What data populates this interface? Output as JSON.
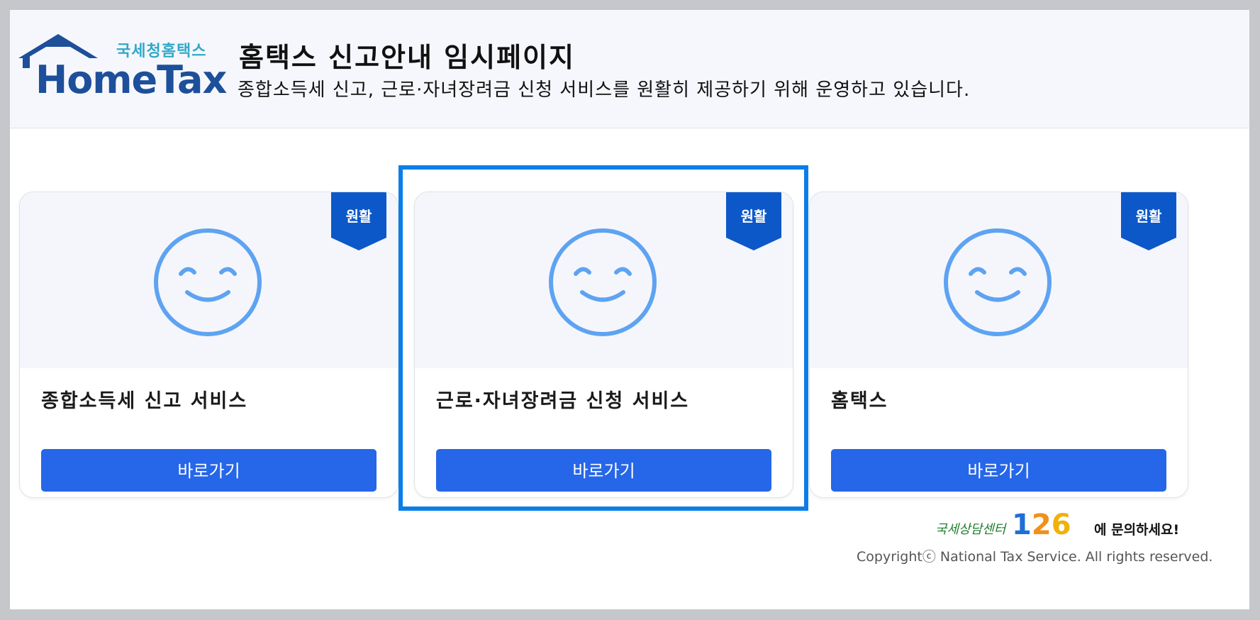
{
  "logo": {
    "subtitle": "국세청홈택스",
    "wordmark": "HomeTax"
  },
  "header": {
    "title": "홈택스 신고안내 임시페이지",
    "description": "종합소득세 신고, 근로·자녀장려금 신청 서비스를 원활히 제공하기 위해 운영하고 있습니다."
  },
  "cards": [
    {
      "status": "원활",
      "title": "종합소득세 신고 서비스",
      "button": "바로가기",
      "icon": "smiley-icon"
    },
    {
      "status": "원활",
      "title": "근로·자녀장려금 신청 서비스",
      "button": "바로가기",
      "icon": "smiley-icon"
    },
    {
      "status": "원활",
      "title": "홈택스",
      "button": "바로가기",
      "icon": "smiley-icon"
    }
  ],
  "footer": {
    "contact_prefix": "국세상담센터",
    "contact_number": [
      "1",
      "2",
      "6"
    ],
    "contact_suffix": "에 문의하세요!",
    "copyright": "Copyrightⓒ National Tax Service. All rights reserved."
  },
  "colors": {
    "brand_blue": "#1d4f9a",
    "accent_teal": "#32a9c8",
    "button_blue": "#2666e8",
    "ribbon_blue": "#0d58c9",
    "smiley_blue": "#5ea3f2",
    "highlight_blue": "#0a7ee8"
  }
}
